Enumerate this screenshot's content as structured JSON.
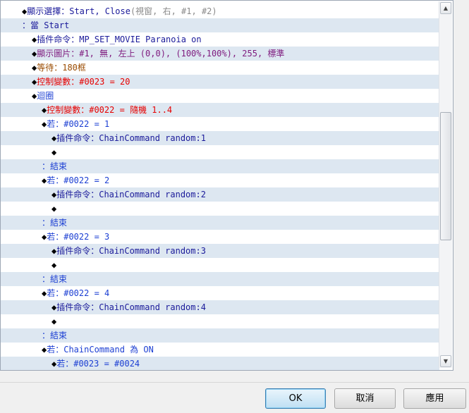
{
  "rows": [
    {
      "indent": 30,
      "parts": [
        {
          "t": "◆",
          "c": "diamond"
        },
        {
          "t": "顯示選擇：Start, Close ",
          "c": "c-navy"
        },
        {
          "t": "(視窗, 右, #1, #2)",
          "c": "c-gray"
        }
      ]
    },
    {
      "indent": 30,
      "parts": [
        {
          "t": "：當 Start",
          "c": "c-navy"
        }
      ]
    },
    {
      "indent": 44,
      "parts": [
        {
          "t": "◆",
          "c": "diamond"
        },
        {
          "t": "插件命令：MP_SET_MOVIE Paranoia on",
          "c": "c-navy"
        }
      ]
    },
    {
      "indent": 44,
      "parts": [
        {
          "t": "◆",
          "c": "diamond"
        },
        {
          "t": "顯示圖片：#1, 無, 左上 (0,0), (100%,100%), 255, 標準",
          "c": "c-purple"
        }
      ]
    },
    {
      "indent": 44,
      "parts": [
        {
          "t": "◆",
          "c": "diamond"
        },
        {
          "t": "等待：180框",
          "c": "c-brown"
        }
      ]
    },
    {
      "indent": 44,
      "parts": [
        {
          "t": "◆",
          "c": "diamond"
        },
        {
          "t": "控制變數：#0023 = 20",
          "c": "c-red"
        }
      ]
    },
    {
      "indent": 44,
      "parts": [
        {
          "t": "◆",
          "c": "diamond"
        },
        {
          "t": "迴圈",
          "c": "c-blue"
        }
      ]
    },
    {
      "indent": 58,
      "parts": [
        {
          "t": "◆",
          "c": "diamond"
        },
        {
          "t": "控制變數：#0022 = 隨機 1..4",
          "c": "c-red"
        }
      ]
    },
    {
      "indent": 58,
      "parts": [
        {
          "t": "◆",
          "c": "diamond"
        },
        {
          "t": "若：#0022 = 1",
          "c": "c-blue"
        }
      ]
    },
    {
      "indent": 72,
      "parts": [
        {
          "t": "◆",
          "c": "diamond"
        },
        {
          "t": "插件命令：ChainCommand random:1",
          "c": "c-navy"
        }
      ]
    },
    {
      "indent": 72,
      "parts": [
        {
          "t": "◆",
          "c": "diamond"
        }
      ]
    },
    {
      "indent": 58,
      "parts": [
        {
          "t": "：結束",
          "c": "c-blue"
        }
      ]
    },
    {
      "indent": 58,
      "parts": [
        {
          "t": "◆",
          "c": "diamond"
        },
        {
          "t": "若：#0022 = 2",
          "c": "c-blue"
        }
      ]
    },
    {
      "indent": 72,
      "parts": [
        {
          "t": "◆",
          "c": "diamond"
        },
        {
          "t": "插件命令：ChainCommand random:2",
          "c": "c-navy"
        }
      ]
    },
    {
      "indent": 72,
      "parts": [
        {
          "t": "◆",
          "c": "diamond"
        }
      ]
    },
    {
      "indent": 58,
      "parts": [
        {
          "t": "：結束",
          "c": "c-blue"
        }
      ]
    },
    {
      "indent": 58,
      "parts": [
        {
          "t": "◆",
          "c": "diamond"
        },
        {
          "t": "若：#0022 = 3",
          "c": "c-blue"
        }
      ]
    },
    {
      "indent": 72,
      "parts": [
        {
          "t": "◆",
          "c": "diamond"
        },
        {
          "t": "插件命令：ChainCommand random:3",
          "c": "c-navy"
        }
      ]
    },
    {
      "indent": 72,
      "parts": [
        {
          "t": "◆",
          "c": "diamond"
        }
      ]
    },
    {
      "indent": 58,
      "parts": [
        {
          "t": "：結束",
          "c": "c-blue"
        }
      ]
    },
    {
      "indent": 58,
      "parts": [
        {
          "t": "◆",
          "c": "diamond"
        },
        {
          "t": "若：#0022 = 4",
          "c": "c-blue"
        }
      ]
    },
    {
      "indent": 72,
      "parts": [
        {
          "t": "◆",
          "c": "diamond"
        },
        {
          "t": "插件命令：ChainCommand random:4",
          "c": "c-navy"
        }
      ]
    },
    {
      "indent": 72,
      "parts": [
        {
          "t": "◆",
          "c": "diamond"
        }
      ]
    },
    {
      "indent": 58,
      "parts": [
        {
          "t": "：結束",
          "c": "c-blue"
        }
      ]
    },
    {
      "indent": 58,
      "parts": [
        {
          "t": "◆",
          "c": "diamond"
        },
        {
          "t": "若：ChainCommand 為 ON",
          "c": "c-blue"
        }
      ]
    },
    {
      "indent": 72,
      "parts": [
        {
          "t": "◆",
          "c": "diamond"
        },
        {
          "t": "若：#0023 = #0024",
          "c": "c-blue"
        }
      ]
    }
  ],
  "scrollbar": {
    "up_icon": "▲",
    "down_icon": "▼"
  },
  "buttons": {
    "ok": "OK",
    "cancel": "取消",
    "apply": "應用"
  }
}
